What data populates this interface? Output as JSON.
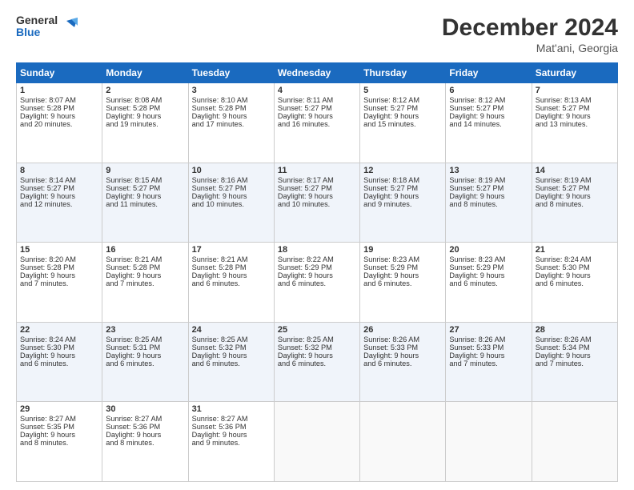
{
  "logo": {
    "line1": "General",
    "line2": "Blue"
  },
  "header": {
    "month_year": "December 2024",
    "location": "Mat'ani, Georgia"
  },
  "days_of_week": [
    "Sunday",
    "Monday",
    "Tuesday",
    "Wednesday",
    "Thursday",
    "Friday",
    "Saturday"
  ],
  "weeks": [
    [
      {
        "day": "1",
        "lines": [
          "Sunrise: 8:07 AM",
          "Sunset: 5:28 PM",
          "Daylight: 9 hours",
          "and 20 minutes."
        ]
      },
      {
        "day": "2",
        "lines": [
          "Sunrise: 8:08 AM",
          "Sunset: 5:28 PM",
          "Daylight: 9 hours",
          "and 19 minutes."
        ]
      },
      {
        "day": "3",
        "lines": [
          "Sunrise: 8:10 AM",
          "Sunset: 5:28 PM",
          "Daylight: 9 hours",
          "and 17 minutes."
        ]
      },
      {
        "day": "4",
        "lines": [
          "Sunrise: 8:11 AM",
          "Sunset: 5:27 PM",
          "Daylight: 9 hours",
          "and 16 minutes."
        ]
      },
      {
        "day": "5",
        "lines": [
          "Sunrise: 8:12 AM",
          "Sunset: 5:27 PM",
          "Daylight: 9 hours",
          "and 15 minutes."
        ]
      },
      {
        "day": "6",
        "lines": [
          "Sunrise: 8:12 AM",
          "Sunset: 5:27 PM",
          "Daylight: 9 hours",
          "and 14 minutes."
        ]
      },
      {
        "day": "7",
        "lines": [
          "Sunrise: 8:13 AM",
          "Sunset: 5:27 PM",
          "Daylight: 9 hours",
          "and 13 minutes."
        ]
      }
    ],
    [
      {
        "day": "8",
        "lines": [
          "Sunrise: 8:14 AM",
          "Sunset: 5:27 PM",
          "Daylight: 9 hours",
          "and 12 minutes."
        ]
      },
      {
        "day": "9",
        "lines": [
          "Sunrise: 8:15 AM",
          "Sunset: 5:27 PM",
          "Daylight: 9 hours",
          "and 11 minutes."
        ]
      },
      {
        "day": "10",
        "lines": [
          "Sunrise: 8:16 AM",
          "Sunset: 5:27 PM",
          "Daylight: 9 hours",
          "and 10 minutes."
        ]
      },
      {
        "day": "11",
        "lines": [
          "Sunrise: 8:17 AM",
          "Sunset: 5:27 PM",
          "Daylight: 9 hours",
          "and 10 minutes."
        ]
      },
      {
        "day": "12",
        "lines": [
          "Sunrise: 8:18 AM",
          "Sunset: 5:27 PM",
          "Daylight: 9 hours",
          "and 9 minutes."
        ]
      },
      {
        "day": "13",
        "lines": [
          "Sunrise: 8:19 AM",
          "Sunset: 5:27 PM",
          "Daylight: 9 hours",
          "and 8 minutes."
        ]
      },
      {
        "day": "14",
        "lines": [
          "Sunrise: 8:19 AM",
          "Sunset: 5:27 PM",
          "Daylight: 9 hours",
          "and 8 minutes."
        ]
      }
    ],
    [
      {
        "day": "15",
        "lines": [
          "Sunrise: 8:20 AM",
          "Sunset: 5:28 PM",
          "Daylight: 9 hours",
          "and 7 minutes."
        ]
      },
      {
        "day": "16",
        "lines": [
          "Sunrise: 8:21 AM",
          "Sunset: 5:28 PM",
          "Daylight: 9 hours",
          "and 7 minutes."
        ]
      },
      {
        "day": "17",
        "lines": [
          "Sunrise: 8:21 AM",
          "Sunset: 5:28 PM",
          "Daylight: 9 hours",
          "and 6 minutes."
        ]
      },
      {
        "day": "18",
        "lines": [
          "Sunrise: 8:22 AM",
          "Sunset: 5:29 PM",
          "Daylight: 9 hours",
          "and 6 minutes."
        ]
      },
      {
        "day": "19",
        "lines": [
          "Sunrise: 8:23 AM",
          "Sunset: 5:29 PM",
          "Daylight: 9 hours",
          "and 6 minutes."
        ]
      },
      {
        "day": "20",
        "lines": [
          "Sunrise: 8:23 AM",
          "Sunset: 5:29 PM",
          "Daylight: 9 hours",
          "and 6 minutes."
        ]
      },
      {
        "day": "21",
        "lines": [
          "Sunrise: 8:24 AM",
          "Sunset: 5:30 PM",
          "Daylight: 9 hours",
          "and 6 minutes."
        ]
      }
    ],
    [
      {
        "day": "22",
        "lines": [
          "Sunrise: 8:24 AM",
          "Sunset: 5:30 PM",
          "Daylight: 9 hours",
          "and 6 minutes."
        ]
      },
      {
        "day": "23",
        "lines": [
          "Sunrise: 8:25 AM",
          "Sunset: 5:31 PM",
          "Daylight: 9 hours",
          "and 6 minutes."
        ]
      },
      {
        "day": "24",
        "lines": [
          "Sunrise: 8:25 AM",
          "Sunset: 5:32 PM",
          "Daylight: 9 hours",
          "and 6 minutes."
        ]
      },
      {
        "day": "25",
        "lines": [
          "Sunrise: 8:25 AM",
          "Sunset: 5:32 PM",
          "Daylight: 9 hours",
          "and 6 minutes."
        ]
      },
      {
        "day": "26",
        "lines": [
          "Sunrise: 8:26 AM",
          "Sunset: 5:33 PM",
          "Daylight: 9 hours",
          "and 6 minutes."
        ]
      },
      {
        "day": "27",
        "lines": [
          "Sunrise: 8:26 AM",
          "Sunset: 5:33 PM",
          "Daylight: 9 hours",
          "and 7 minutes."
        ]
      },
      {
        "day": "28",
        "lines": [
          "Sunrise: 8:26 AM",
          "Sunset: 5:34 PM",
          "Daylight: 9 hours",
          "and 7 minutes."
        ]
      }
    ],
    [
      {
        "day": "29",
        "lines": [
          "Sunrise: 8:27 AM",
          "Sunset: 5:35 PM",
          "Daylight: 9 hours",
          "and 8 minutes."
        ]
      },
      {
        "day": "30",
        "lines": [
          "Sunrise: 8:27 AM",
          "Sunset: 5:36 PM",
          "Daylight: 9 hours",
          "and 8 minutes."
        ]
      },
      {
        "day": "31",
        "lines": [
          "Sunrise: 8:27 AM",
          "Sunset: 5:36 PM",
          "Daylight: 9 hours",
          "and 9 minutes."
        ]
      },
      null,
      null,
      null,
      null
    ]
  ]
}
